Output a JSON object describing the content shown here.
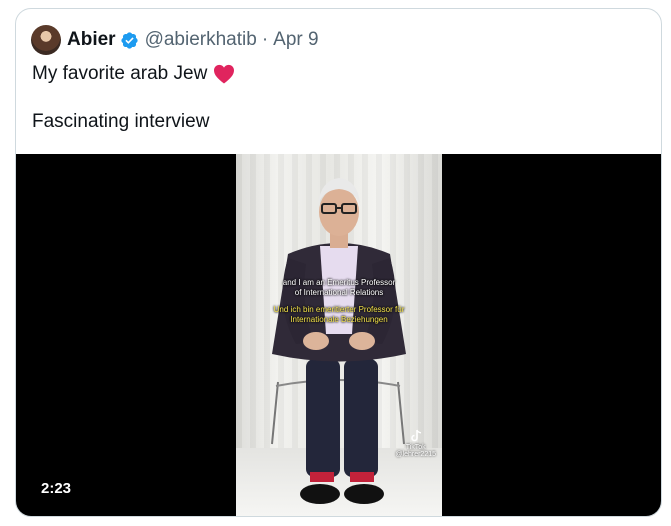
{
  "tweet": {
    "author_name": "Abier",
    "handle": "@abierkhatib",
    "separator": "·",
    "date": "Apr 9",
    "line1": "My favorite arab Jew",
    "line2": "Fascinating interview"
  },
  "video": {
    "duration": "2:23",
    "subtitle_en_1": "and I am an Emeritus Professor",
    "subtitle_en_2": "of International Relations",
    "subtitle_de_1": "Und ich bin emeritierter Professor für",
    "subtitle_de_2": "Internationale Beziehungen",
    "watermark_brand": "TikTok",
    "watermark_user": "@lehrer2215"
  },
  "colors": {
    "text": "#0f1419",
    "secondary": "#536471",
    "verified": "#1d9bf0",
    "heart": "#e0245e",
    "border": "#cfd9de"
  },
  "icons": [
    "verified-badge-icon",
    "red-heart-icon",
    "tiktok-logo-icon"
  ]
}
